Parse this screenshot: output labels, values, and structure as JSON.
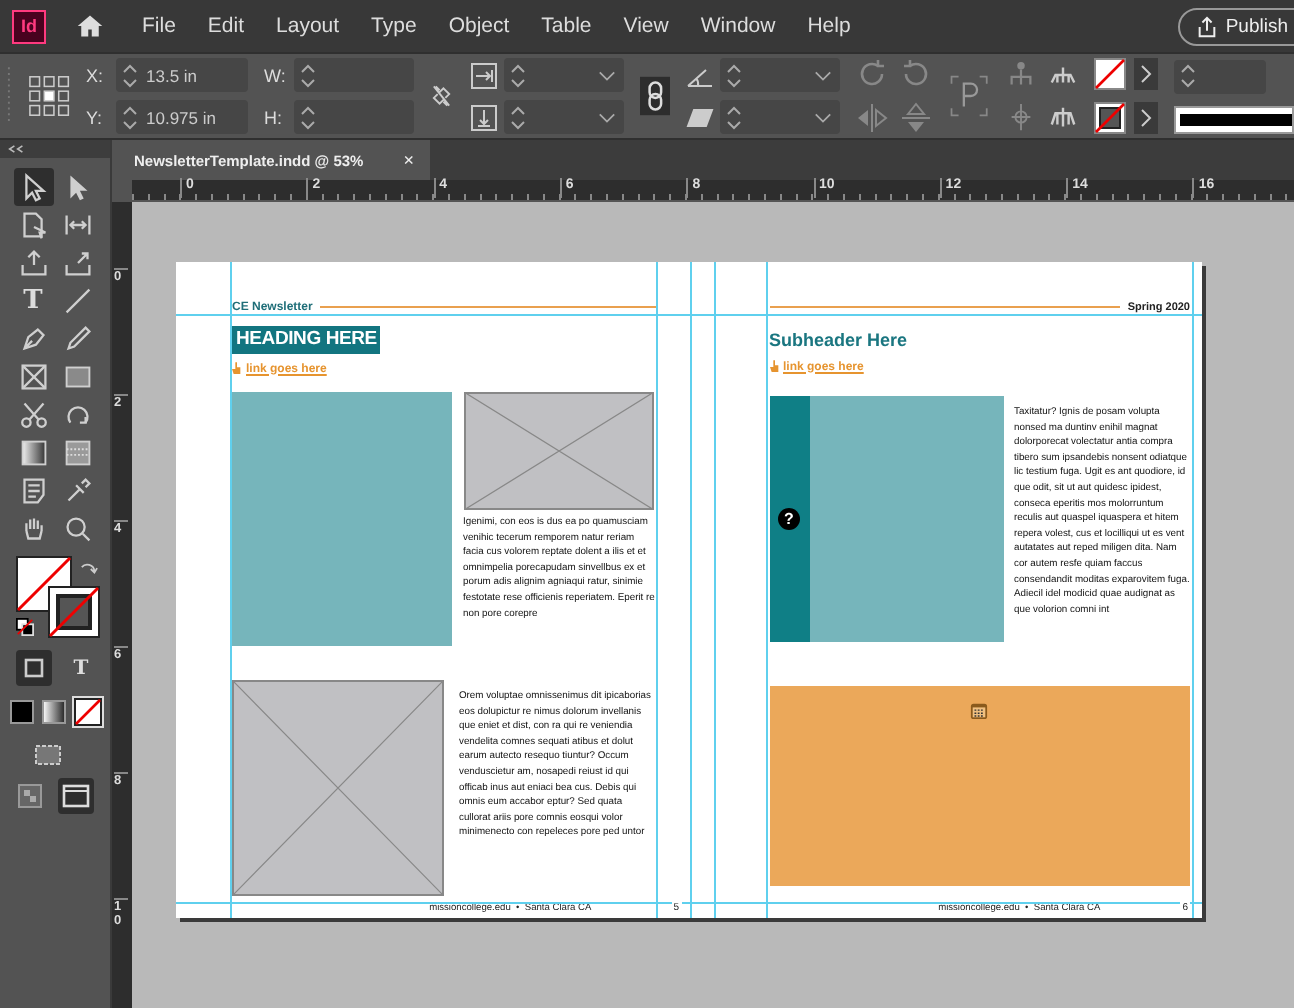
{
  "app": {
    "logo": "Id"
  },
  "menu": [
    "File",
    "Edit",
    "Layout",
    "Type",
    "Object",
    "Table",
    "View",
    "Window",
    "Help"
  ],
  "publish_button": "Publish",
  "control_bar": {
    "fields": [
      {
        "label": "X:",
        "value": "13.5 in"
      },
      {
        "label": "Y:",
        "value": "10.975 in"
      },
      {
        "label": "W:"
      },
      {
        "label": "H:"
      }
    ]
  },
  "document_tab": {
    "title": "NewsletterTemplate.indd @ 53%",
    "close": "×"
  },
  "rulers": {
    "horizontal": [
      "0",
      "2",
      "4",
      "6",
      "8",
      "10",
      "12",
      "14",
      "16"
    ],
    "vertical": [
      "0",
      "2",
      "4",
      "6",
      "8",
      "10"
    ]
  },
  "tools": [
    {
      "kind": "selection",
      "selected": true
    },
    {
      "kind": "direct-selection",
      "selected": false
    },
    {
      "kind": "page",
      "selected": false
    },
    {
      "kind": "gap",
      "selected": false
    },
    {
      "kind": "content-collector",
      "selected": false
    },
    {
      "kind": "content-placer",
      "selected": false
    },
    {
      "kind": "type",
      "glyph": "T",
      "selected": false
    },
    {
      "kind": "line",
      "selected": false
    },
    {
      "kind": "pen",
      "selected": false
    },
    {
      "kind": "pencil",
      "selected": false
    },
    {
      "kind": "frame",
      "selected": false
    },
    {
      "kind": "rectangle",
      "selected": false
    },
    {
      "kind": "scissors",
      "selected": false
    },
    {
      "kind": "free-transform",
      "selected": false
    },
    {
      "kind": "gradient",
      "selected": false
    },
    {
      "kind": "gradient-feather",
      "selected": false
    },
    {
      "kind": "note",
      "selected": false
    },
    {
      "kind": "eyedropper",
      "selected": false
    },
    {
      "kind": "hand",
      "selected": false
    },
    {
      "kind": "zoom",
      "selected": false
    }
  ],
  "text_formatting_glyph": "T",
  "left_page": {
    "header": "CE Newsletter",
    "heading": "HEADING HERE",
    "link": "link goes here",
    "text_1": "Igenimi, con eos is dus ea po quamusciam venihic tecerum remporem natur reriam facia cus volorem reptate dolent a ilis et et omnimpelia porecapudam sinvellbus ex et porum adis alignim agniaqui ratur, sinimie festotate rese officienis reperiatem. Eperit re non pore corepre",
    "text_2": "Orem voluptae omnissenimus dit ipicaborias eos dolupictur re nimus dolorum invellanis que eniet et dist, con ra qui re veniendia vendelita comnes sequati atibus et dolut earum autecto resequo tiuntur? Occum venduscietur am, nosapedi reiust id qui officab inus aut eniaci bea cus. Debis qui omnis eum accabor eptur? Sed quata cullorat ariis pore comnis eosqui volor minimenecto con repeleces pore ped untor",
    "footer": "missioncollege.edu  •  Santa Clara CA",
    "page_number": "5"
  },
  "right_page": {
    "header": "Spring 2020",
    "subheader": "Subheader Here",
    "link": "link goes here",
    "placeholder_glyph": "?",
    "text": "Taxitatur? Ignis de posam volupta nonsed ma duntinv enihil magnat dolorporecat volectatur antia compra tibero sum ipsandebis nonsent odiatque lic testium fuga. Ugit es ant quodiore, id que odit, sit ut aut quidesc ipidest, conseca eperitis mos molorruntum reculis aut quaspel iquaspera et hitem repera volest, cus et locilliqui ut es vent autatates aut reped miligen dita. Nam cor autem resfe quiam faccus consendandit moditas exparovitem fuga. Adiecil idel modicid quae audignat as que volorion comni int",
    "footer": "missioncollege.edu  •  Santa Clara CA",
    "page_number": "6"
  }
}
